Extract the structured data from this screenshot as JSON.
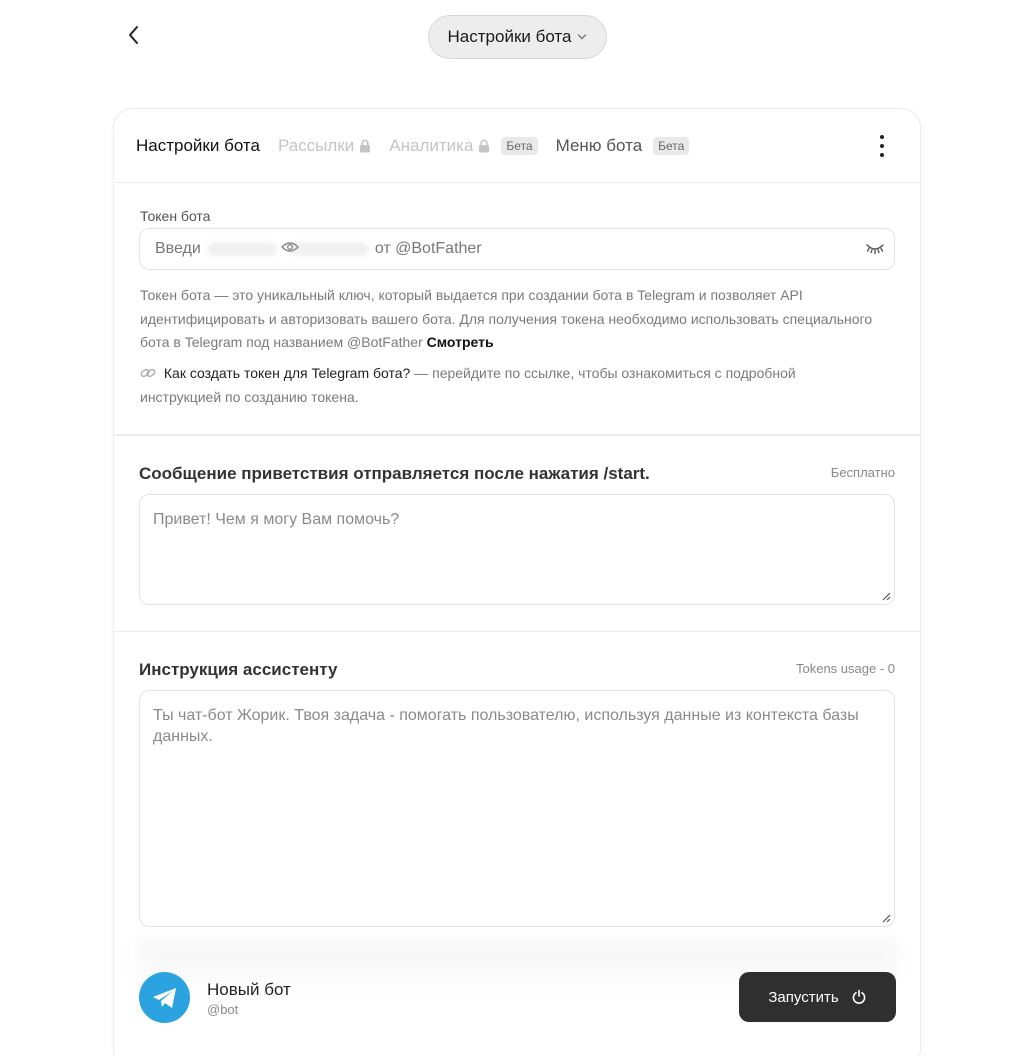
{
  "header": {
    "title": "Настройки бота"
  },
  "tabs": [
    {
      "label": "Настройки бота",
      "state": "active"
    },
    {
      "label": "Рассылки",
      "state": "locked"
    },
    {
      "label": "Аналитика",
      "state": "locked",
      "badge": "Бета"
    },
    {
      "label": "Меню бота",
      "state": "normal",
      "badge": "Бета"
    }
  ],
  "token": {
    "label": "Токен бота",
    "placeholder_start": "Введи",
    "placeholder_end": "от @BotFather",
    "help_text": "Токен бота — это уникальный ключ, который выдается при создании бота в Telegram и позволяет API идентифицировать и авторизовать вашего бота. Для получения токена необходимо использовать специального бота в Telegram под названием @BotFather",
    "help_link": "Смотреть",
    "guide_link": "Как создать токен для Telegram бота?",
    "guide_text": "— перейдите по ссылке, чтобы ознакомиться с подробной инструкцией по созданию токена."
  },
  "welcome": {
    "title": "Сообщение приветствия отправляется после нажатия /start.",
    "meta": "Бесплатно",
    "placeholder": "Привет! Чем я могу Вам помочь?"
  },
  "instruction": {
    "title": "Инструкция ассистенту",
    "meta": "Tokens usage - 0",
    "placeholder": "Ты чат-бот Жорик. Твоя задача - помогать пользователю, используя данные из контекста базы данных."
  },
  "bot": {
    "name": "Новый бот",
    "handle": "@bot"
  },
  "actions": {
    "run_label": "Запустить"
  },
  "colors": {
    "accent": "#2f2f2f",
    "telegram": "#2aa3e0"
  }
}
